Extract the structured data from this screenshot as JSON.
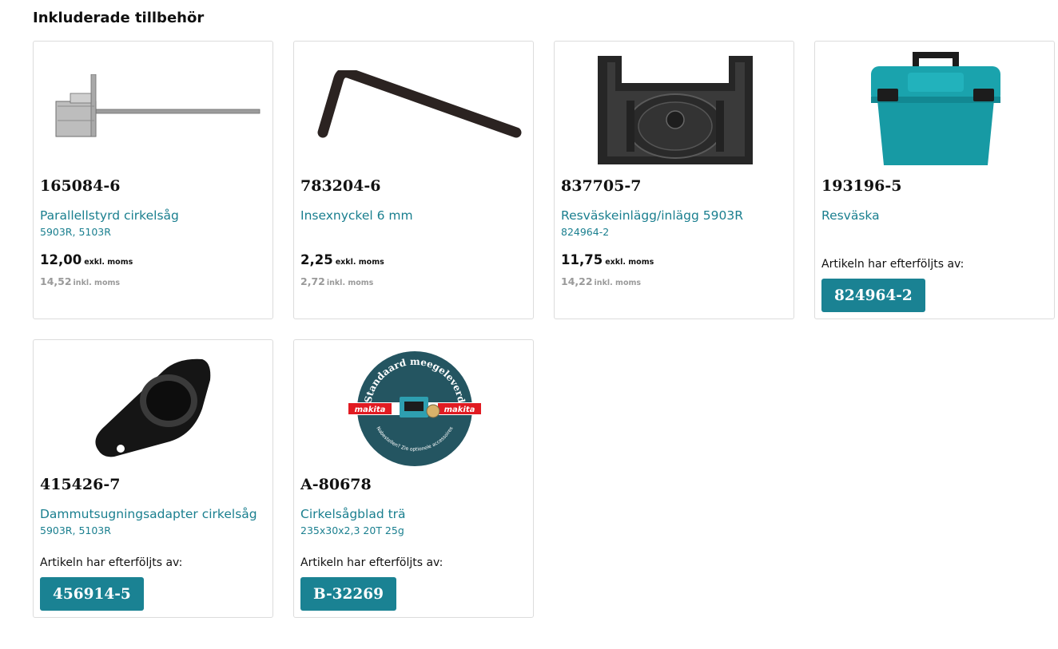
{
  "section_title": "Inkluderade tillbehör",
  "cards": [
    {
      "sku": "165084-6",
      "name": "Parallellstyrd cirkelsåg",
      "sub": "5903R, 5103R",
      "price": "12,00",
      "price_label": "exkl. moms",
      "price_incl": "14,52",
      "price_incl_label": "inkl. moms",
      "image": "parallel-guide-image"
    },
    {
      "sku": "783204-6",
      "name": "Insexnyckel 6 mm",
      "sub": "",
      "price": "2,25",
      "price_label": "exkl. moms",
      "price_incl": "2,72",
      "price_incl_label": "inkl. moms",
      "image": "hex-key-image"
    },
    {
      "sku": "837705-7",
      "name": "Resväskeinlägg/inlägg 5903R",
      "sub": "824964-2",
      "price": "11,75",
      "price_label": "exkl. moms",
      "price_incl": "14,22",
      "price_incl_label": "inkl. moms",
      "image": "case-inlay-image"
    },
    {
      "sku": "193196-5",
      "name": "Resväska",
      "sub": "",
      "succeeded_text": "Artikeln har efterföljts av:",
      "succeeded_by": "824964-2",
      "image": "carry-case-image"
    },
    {
      "sku": "415426-7",
      "name": "Dammutsugningsadapter cirkelsåg",
      "sub": "5903R, 5103R",
      "succeeded_text": "Artikeln har efterföljts av:",
      "succeeded_by": "456914-5",
      "image": "dust-adapter-image"
    },
    {
      "sku": "A-80678",
      "name": "Cirkelsågblad trä",
      "sub": "235x30x2,3 20T 25g",
      "succeeded_text": "Artikeln har efterföljts av:",
      "succeeded_by": "B-32269",
      "image": "standard-badge-image"
    }
  ],
  "badge": {
    "top_text": "Standaard meegeleverd",
    "bottom_text": "Nabestellen? Zie optionele accessoires",
    "brand": "makita"
  },
  "colors": {
    "link": "#1a7f8f",
    "button": "#1a8293",
    "badge_bg": "#245561",
    "brand_red": "#e11b22",
    "case_teal": "#1aa3ad"
  }
}
